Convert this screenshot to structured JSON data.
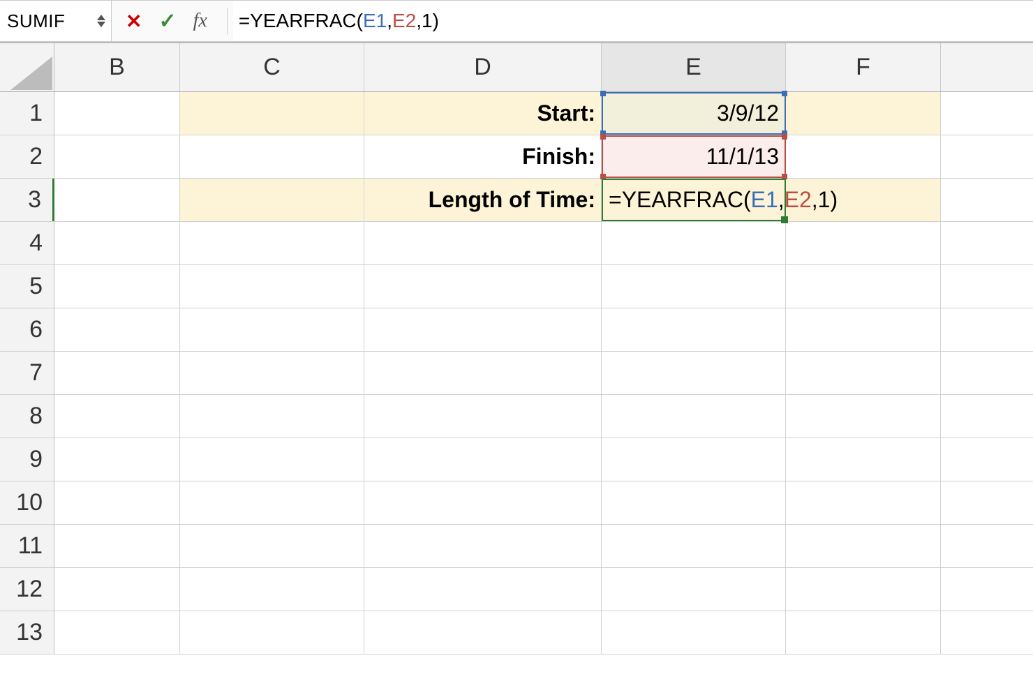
{
  "formula_bar": {
    "name_box": "SUMIF",
    "fx_label": "fx",
    "formula_fn": "=YEARFRAC(",
    "formula_ref1": "E1",
    "formula_sep": ",",
    "formula_ref2": "E2",
    "formula_tail": ",1)"
  },
  "columns": [
    "B",
    "C",
    "D",
    "E",
    "F"
  ],
  "rows": [
    "1",
    "2",
    "3",
    "4",
    "5",
    "6",
    "7",
    "8",
    "9",
    "10",
    "11",
    "12",
    "13"
  ],
  "cells": {
    "D1": "Start:",
    "E1": "3/9/12",
    "D2": "Finish:",
    "E2": "11/1/13",
    "D3": "Length of Time:",
    "E3_formula_fn": "=YEARFRAC(",
    "E3_formula_ref1": "E1",
    "E3_formula_sep": ",",
    "E3_formula_ref2": "E2",
    "E3_formula_tail": ",1)"
  }
}
